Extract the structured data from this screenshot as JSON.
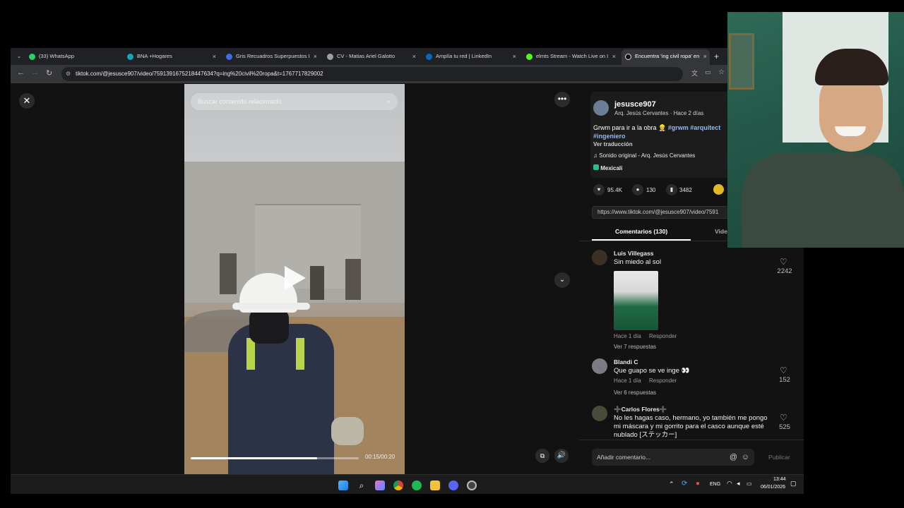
{
  "tabs": [
    {
      "label": "(33) WhatsApp",
      "color": "#25d366"
    },
    {
      "label": "BNA +Hogares",
      "color": "#16a3b5"
    },
    {
      "label": "Gris Recuadros Superpuestos I",
      "color": "#3b6ee0"
    },
    {
      "label": "CV - Matias Ariel Galotto",
      "color": "#9aa0a6"
    },
    {
      "label": "Amplía tu red | LinkedIn",
      "color": "#0a66c2"
    },
    {
      "label": "elmts Stream - Watch Live on I",
      "color": "#53fc18"
    },
    {
      "label": "Encuentra 'ing civil ropa' en",
      "color": "#111111"
    }
  ],
  "address": {
    "url": "tiktok.com/@jesusce907/video/7591391675218447634?q=ing%20civil%20ropa&t=1767717829002"
  },
  "video": {
    "search_placeholder": "Buscar contenido relacionado",
    "time": "00:15/00:20",
    "progress": 0.75
  },
  "author": {
    "username": "jesusce907",
    "subtitle": "Arq. Jesús Cervantes · Hace 2 días",
    "caption": "Grwm para ir a la obra 👷",
    "hashtags": "#grwm #arquitect",
    "hashtag2": "#ingeniero",
    "translate": "Ver traducción",
    "sound": "Sonido original - Arq. Jesús Cervantes",
    "location": "Mexicali"
  },
  "stats": {
    "likes": "95.4K",
    "comments": "130",
    "saves": "3482"
  },
  "share_url": "https://www.tiktok.com/@jesusce907/video/7591",
  "panel_tabs": {
    "comments": "Comentarios (130)",
    "videos": "Vide"
  },
  "comments": [
    {
      "name": "Luis Villegass",
      "text": "Sin miedo al sol",
      "time": "Hace 1 día",
      "reply": "Responder",
      "more": "Ver 7 respuestas",
      "likes": "2242"
    },
    {
      "name": "Blandi C",
      "text": "Que guapo se ve inge 👀",
      "time": "Hace 1 día",
      "reply": "Responder",
      "more": "Ver 6 respuestas",
      "likes": "152"
    },
    {
      "name": "➕Carlos Flores➕",
      "text": "No les hagas caso, hermano, yo también me pongo mi máscara y mi gorrito para el casco aunque esté nublado [ステッカー]",
      "likes": "525"
    }
  ],
  "add_comment": {
    "placeholder": "Añadir comentario...",
    "publish": "Publicar"
  },
  "system_tray": {
    "lang": "ENG",
    "time": "13:44",
    "date": "06/01/2026"
  }
}
